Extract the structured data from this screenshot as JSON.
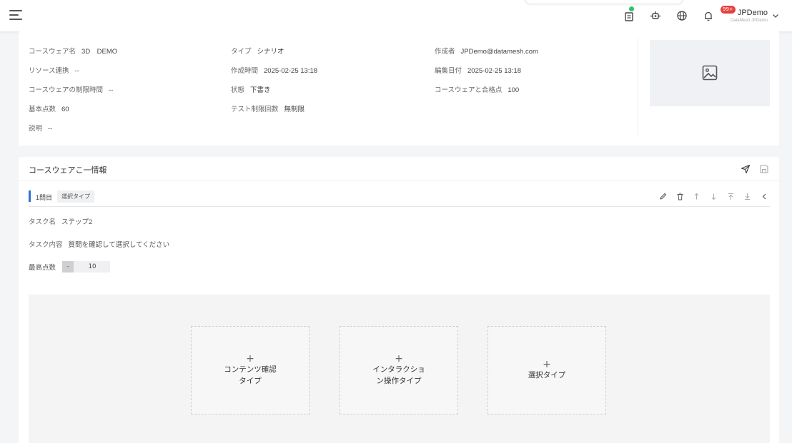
{
  "header": {
    "user_name": "JPDemo",
    "user_sub": "DataMesh JPDemo",
    "badge_count": "99+"
  },
  "info": {
    "name_label": "コースウェア名",
    "name_value": "3D　DEMO",
    "type_label": "タイプ",
    "type_value": "シナリオ",
    "author_label": "作成者",
    "author_value": "JPDemo@datamesh.com",
    "resource_label": "リソース連携",
    "resource_value": "--",
    "created_label": "作成時間",
    "created_value": "2025-02-25 13:18",
    "edited_label": "編集日付",
    "edited_value": "2025-02-25 13:18",
    "limit_label": "コースウェアの制限時間",
    "limit_value": "--",
    "status_label": "状態",
    "status_value": "下書き",
    "pass_label": "コースウェアと合格点",
    "pass_value": "100",
    "base_label": "基本点数",
    "base_value": "60",
    "test_label": "テスト制限回数",
    "test_value": "無制限",
    "desc_label": "説明",
    "desc_value": "--"
  },
  "task": {
    "section_title": "コースウェアこ一情報",
    "question_no": "1問目",
    "question_tag": "選択タイプ",
    "task_name_label": "タスク名",
    "task_name_value": "ステップ2",
    "task_content_label": "タスク内容",
    "task_content_value": "質問を確認して選択してください",
    "max_score_label": "最高点数",
    "max_score_value": "10",
    "stepper_minus": "-",
    "types": [
      {
        "plus": "+",
        "label": "コンテンツ確認\nタイプ"
      },
      {
        "plus": "+",
        "label": "インタラクショ\nン操作タイプ"
      },
      {
        "plus": "+",
        "label": "選択タイプ"
      }
    ]
  },
  "colors": {
    "accent": "#2f6fd6",
    "badge": "#e74040",
    "status_ok": "#31c26b"
  }
}
